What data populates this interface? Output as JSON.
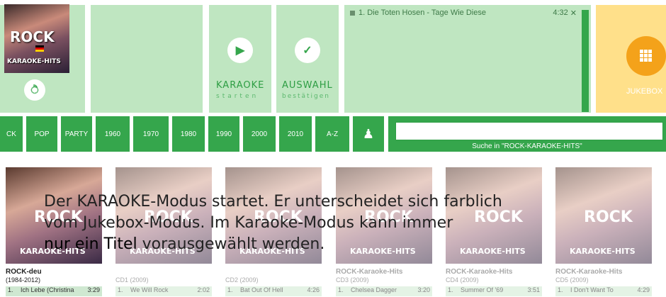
{
  "cover": {
    "title": "ROCK",
    "subtitle": "KARAOKE-HITS"
  },
  "controls": {
    "ear_icon": "ear-icon",
    "karaoke_label": "KARAOKE",
    "karaoke_sub": "starten",
    "confirm_label": "AUSWAHL",
    "confirm_sub": "bestätigen"
  },
  "playlist": {
    "items": [
      {
        "title": "1. Die Toten Hosen - Tage Wie Diese",
        "duration": "4:32"
      }
    ]
  },
  "jukebox": {
    "label": "JUKEBOX"
  },
  "genres": [
    "CK",
    "POP",
    "PARTY",
    "1960",
    "1970",
    "1980",
    "1990",
    "2000",
    "2010",
    "A-Z"
  ],
  "search": {
    "caption": "Suche in \"ROCK-KARAOKE-HITS\"",
    "value": ""
  },
  "albums": [
    {
      "title": "ROCK-deu",
      "year": "(1984-2012)",
      "track_no": "1.",
      "track": "Ich Lebe (Christina",
      "duration": "3:29"
    },
    {
      "title": "",
      "year": "CD1 (2009)",
      "track_no": "1.",
      "track": "We Will Rock",
      "duration": "2:02"
    },
    {
      "title": "",
      "year": "CD2 (2009)",
      "track_no": "1.",
      "track": "Bat Out Of Hell",
      "duration": "4:26"
    },
    {
      "title": "ROCK-Karaoke-Hits",
      "year": "CD3 (2009)",
      "track_no": "1.",
      "track": "Chelsea Dagger",
      "duration": "3:20"
    },
    {
      "title": "ROCK-Karaoke-Hits",
      "year": "CD4 (2009)",
      "track_no": "1.",
      "track": "Summer Of '69",
      "duration": "3:51"
    },
    {
      "title": "ROCK-Karaoke-Hits",
      "year": "CD5 (2009)",
      "track_no": "1.",
      "track": "I Don't Want To",
      "duration": "4:29"
    }
  ],
  "overlay": {
    "line1": "Der KARAOKE-Modus startet. Er unterscheidet sich farblich",
    "line2": "vom Jukebox-Modus. Im Karaoke-Modus kann immer",
    "line3_emph": "nur ein Titel",
    "line3_rest": " vorausgewählt werden."
  },
  "colors": {
    "accent": "#35a64c",
    "panel": "#bfe6c1",
    "jukebox": "#ffe08a",
    "jukebox_btn": "#f4a21a"
  }
}
